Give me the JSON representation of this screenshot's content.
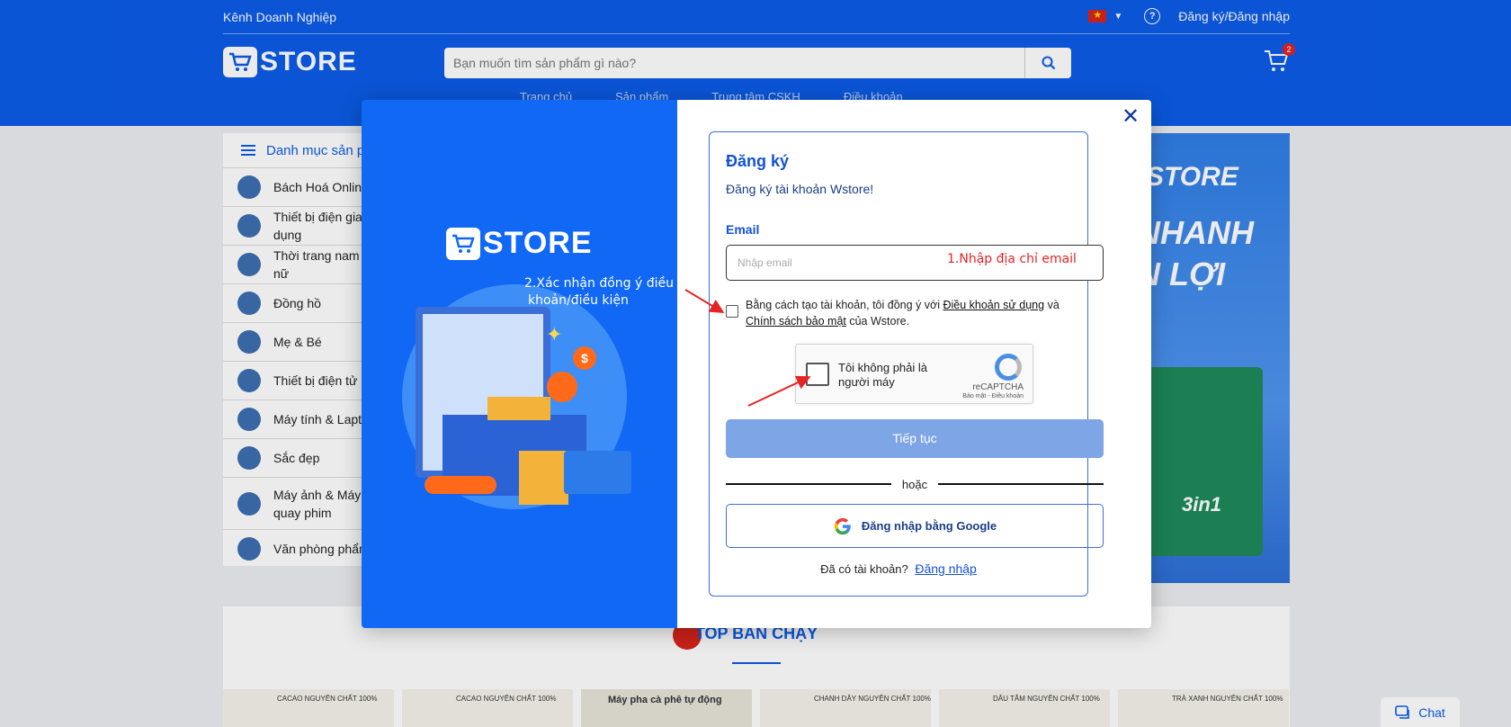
{
  "header": {
    "business_link": "Kênh Doanh Nghiệp",
    "auth_link": "Đăng ký/Đăng nhập",
    "logo_text": "STORE",
    "search_placeholder": "Bạn muốn tìm sản phẩm gì nào?",
    "cart_count": "2",
    "nav": [
      "Trang chủ",
      "Sản phẩm",
      "Trung tâm CSKH",
      "Điều khoản"
    ],
    "brand_color": "#0b5ce8"
  },
  "categories": {
    "title": "Danh mục sản phẩm",
    "items": [
      "Bách Hoá Online",
      "Thiết bị điện gia dụng",
      "Thời trang nam & nữ",
      "Đồng hồ",
      "Mẹ & Bé",
      "Thiết bị điện tử",
      "Máy tính & Laptop",
      "Sắc đẹp",
      "Máy ảnh & Máy quay phim",
      "Văn phòng phẩm"
    ]
  },
  "banner": {
    "lines": [
      "STORE",
      "NHANH",
      "N LỢI",
      "3in1"
    ]
  },
  "best_sellers": {
    "title": "TOP BÁN CHẠY",
    "products": [
      "CACAO NGUYÊN CHẤT 100%",
      "CACAO NGUYÊN CHẤT 100%",
      "Máy pha cà phê tự động",
      "CHANH DÂY NGUYÊN CHẤT 100%",
      "DÂU TẰM NGUYÊN CHẤT 100%",
      "TRÀ XANH NGUYÊN CHẤT 100%"
    ]
  },
  "chat": {
    "label": "Chat"
  },
  "modal": {
    "logo_text": "STORE",
    "title": "Đăng ký",
    "subtitle": "Đăng ký tài khoản Wstore!",
    "email_label": "Email",
    "email_placeholder": "Nhập email",
    "terms_prefix": "Bằng cách tạo tài khoản, tôi đồng ý với",
    "terms_link": "Điều khoản sử dụng",
    "terms_and": "và",
    "privacy_link": "Chính sách bảo mật",
    "terms_suffix": "của Wstore.",
    "captcha_label": "Tôi không phải là người máy",
    "captcha_brand": "reCAPTCHA",
    "captcha_links": "Bảo mật - Điều khoản",
    "submit_label": "Tiếp tục",
    "or_label": "hoặc",
    "google_label": "Đăng nhập bằng Google",
    "have_account": "Đã có tài khoản?",
    "login_link": "Đăng nhập"
  },
  "annotations": {
    "email_hint": "1.Nhập địa chỉ email",
    "terms_hint_line1": "2.Xác nhận đồng ý điều",
    "terms_hint_line2": "khoản/điều kiện",
    "arrow_color": "#e52424"
  }
}
